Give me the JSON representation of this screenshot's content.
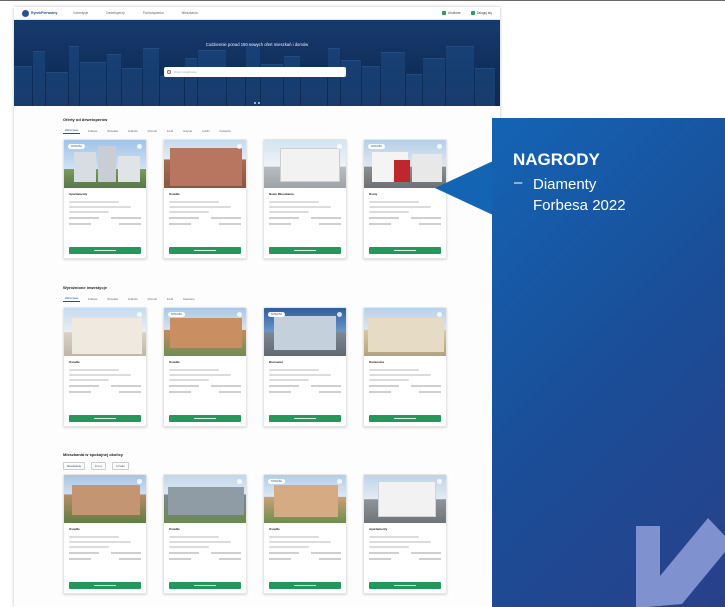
{
  "awards_panel": {
    "title": "NAGRODY",
    "dash": "–",
    "item_line1": "Diamenty",
    "item_line2": "Forbesa 2022"
  },
  "screenshot": {
    "hero_title": "Codziennie ponad 150 nowych ofert mieszkań i domów",
    "sections": [
      {
        "title": "Oferty od deweloperów"
      },
      {
        "title": "Wyróżnione inwestycje"
      },
      {
        "title": "Mieszkania w spokojnej okolicy"
      }
    ]
  },
  "colors": {
    "panel_blue": "#1464b4",
    "panel_violet": "#28408a",
    "button_green": "#24975a",
    "arrow_light": "#8a9ad6"
  },
  "icons": [
    "logo-icon",
    "search-icon",
    "heart-icon",
    "arrow-down-left-icon"
  ]
}
